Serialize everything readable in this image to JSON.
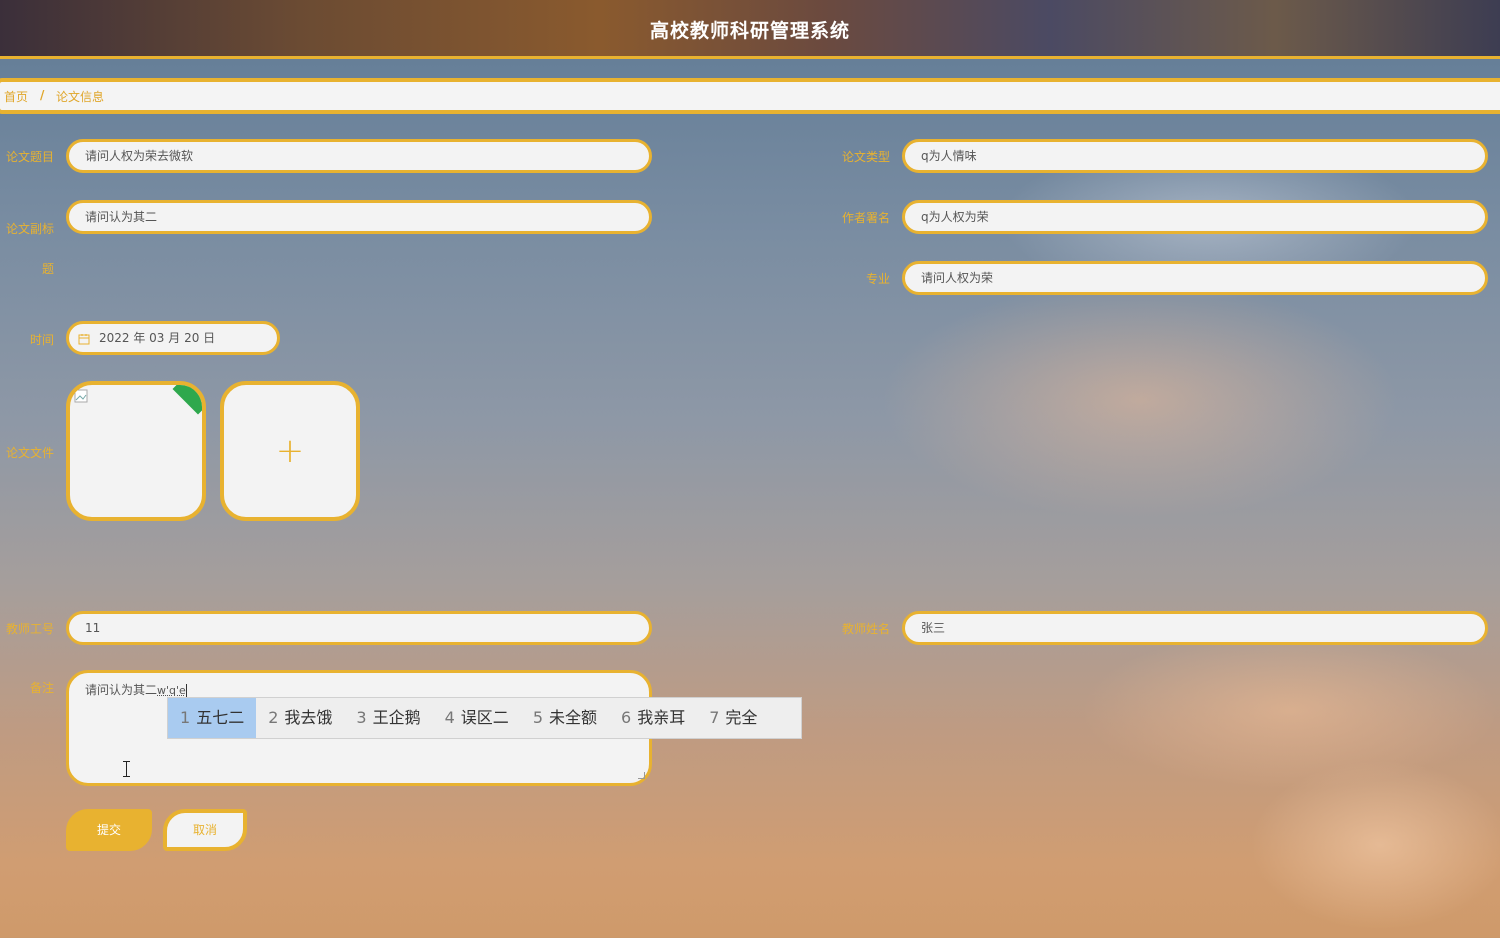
{
  "header": {
    "title": "高校教师科研管理系统"
  },
  "breadcrumb": {
    "home": "首页",
    "separator": "/",
    "current": "论文信息"
  },
  "form": {
    "title_label": "论文题目",
    "title_value": "请问人权为荣去微软",
    "type_label": "论文类型",
    "type_value": "q为人情味",
    "subtitle_label": "论文副标题",
    "subtitle_value": "请问认为其二",
    "author_label": "作者署名",
    "author_value": "q为人权为荣",
    "major_label": "专业",
    "major_value": "请问人权为荣",
    "time_label": "时间",
    "time_value": "2022 年 03 月 20 日",
    "file_label": "论文文件",
    "upload_plus": "+",
    "teacher_id_label": "教师工号",
    "teacher_id_value": "11",
    "teacher_name_label": "教师姓名",
    "teacher_name_value": "张三",
    "remark_label": "备注",
    "remark_value": "请问认为其二",
    "remark_composition": "w'q'e"
  },
  "ime": {
    "candidates": [
      {
        "num": "1",
        "text": "五七二"
      },
      {
        "num": "2",
        "text": "我去饿"
      },
      {
        "num": "3",
        "text": "王企鹅"
      },
      {
        "num": "4",
        "text": "误区二"
      },
      {
        "num": "5",
        "text": "未全额"
      },
      {
        "num": "6",
        "text": "我亲耳"
      },
      {
        "num": "7",
        "text": "完全"
      }
    ]
  },
  "buttons": {
    "submit": "提交",
    "cancel": "取消"
  },
  "colors": {
    "accent": "#e8b230",
    "input_bg": "#f3f3f3",
    "ime_selected": "#a9cbf0"
  },
  "icons": {
    "date": "calendar-icon",
    "upload": "plus-icon",
    "status": "check-badge-icon",
    "cursor": "text-cursor-icon"
  }
}
